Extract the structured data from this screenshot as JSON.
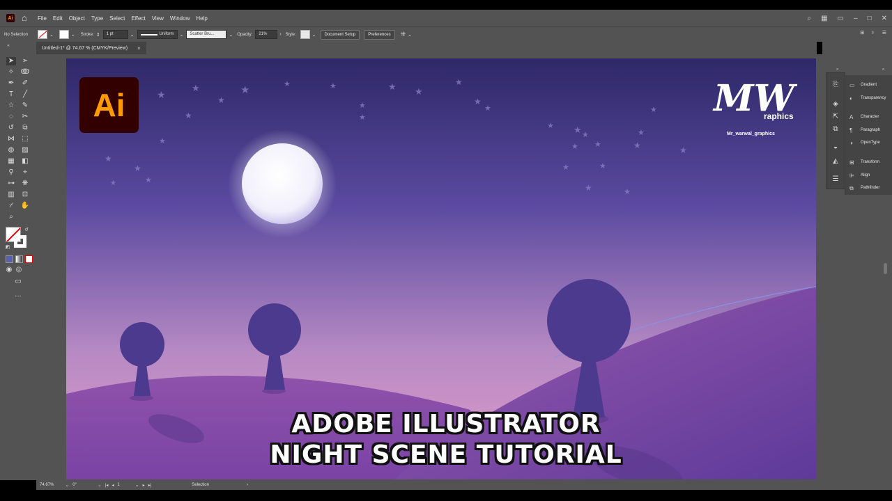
{
  "app": {
    "icon_text": "Ai"
  },
  "menu": {
    "items": [
      "File",
      "Edit",
      "Object",
      "Type",
      "Select",
      "Effect",
      "View",
      "Window",
      "Help"
    ]
  },
  "control_bar": {
    "selection_label": "No Selection",
    "stroke_label": "Stroke:",
    "stroke_value": "1 pt",
    "profile_value": "Uniform",
    "brush_value": "Scatter Bru...",
    "opacity_label": "Opacity:",
    "opacity_value": "21%",
    "style_label": "Style:",
    "document_setup_label": "Document Setup",
    "preferences_label": "Preferences"
  },
  "document_tab": {
    "title": "Untitled-1* @ 74.67 % (CMYK/Preview)",
    "close_glyph": "×"
  },
  "panels": [
    {
      "label": "Gradient",
      "icon": "gradient-icon"
    },
    {
      "label": "Transparency",
      "icon": "transparency-icon"
    },
    {
      "label": "Character",
      "icon": "character-icon"
    },
    {
      "label": "Paragraph",
      "icon": "paragraph-icon"
    },
    {
      "label": "OpenType",
      "icon": "opentype-icon"
    },
    {
      "label": "Transform",
      "icon": "transform-icon"
    },
    {
      "label": "Align",
      "icon": "align-icon"
    },
    {
      "label": "Pathfinder",
      "icon": "pathfinder-icon"
    }
  ],
  "status_bar": {
    "zoom_value": "74.67%",
    "rotation_value": "0°",
    "artboard_value": "1",
    "tool_status": "Selection"
  },
  "artwork": {
    "ai_badge_text": "Ai",
    "watermark_main": "MW",
    "watermark_sub": "raphics",
    "watermark_handle": "Mr_warwal_graphics",
    "caption_line1": "ADOBE ILLUSTRATOR",
    "caption_line2": "NIGHT SCENE TUTORIAL"
  },
  "colors": {
    "ui_gray": "#535353",
    "sky_top": "#2f2968",
    "sky_bottom": "#d18cc4",
    "hill": "#8a4ea6",
    "tree": "#4c3a8e",
    "ai_orange": "#ff9a00",
    "ai_brown": "#330000"
  }
}
